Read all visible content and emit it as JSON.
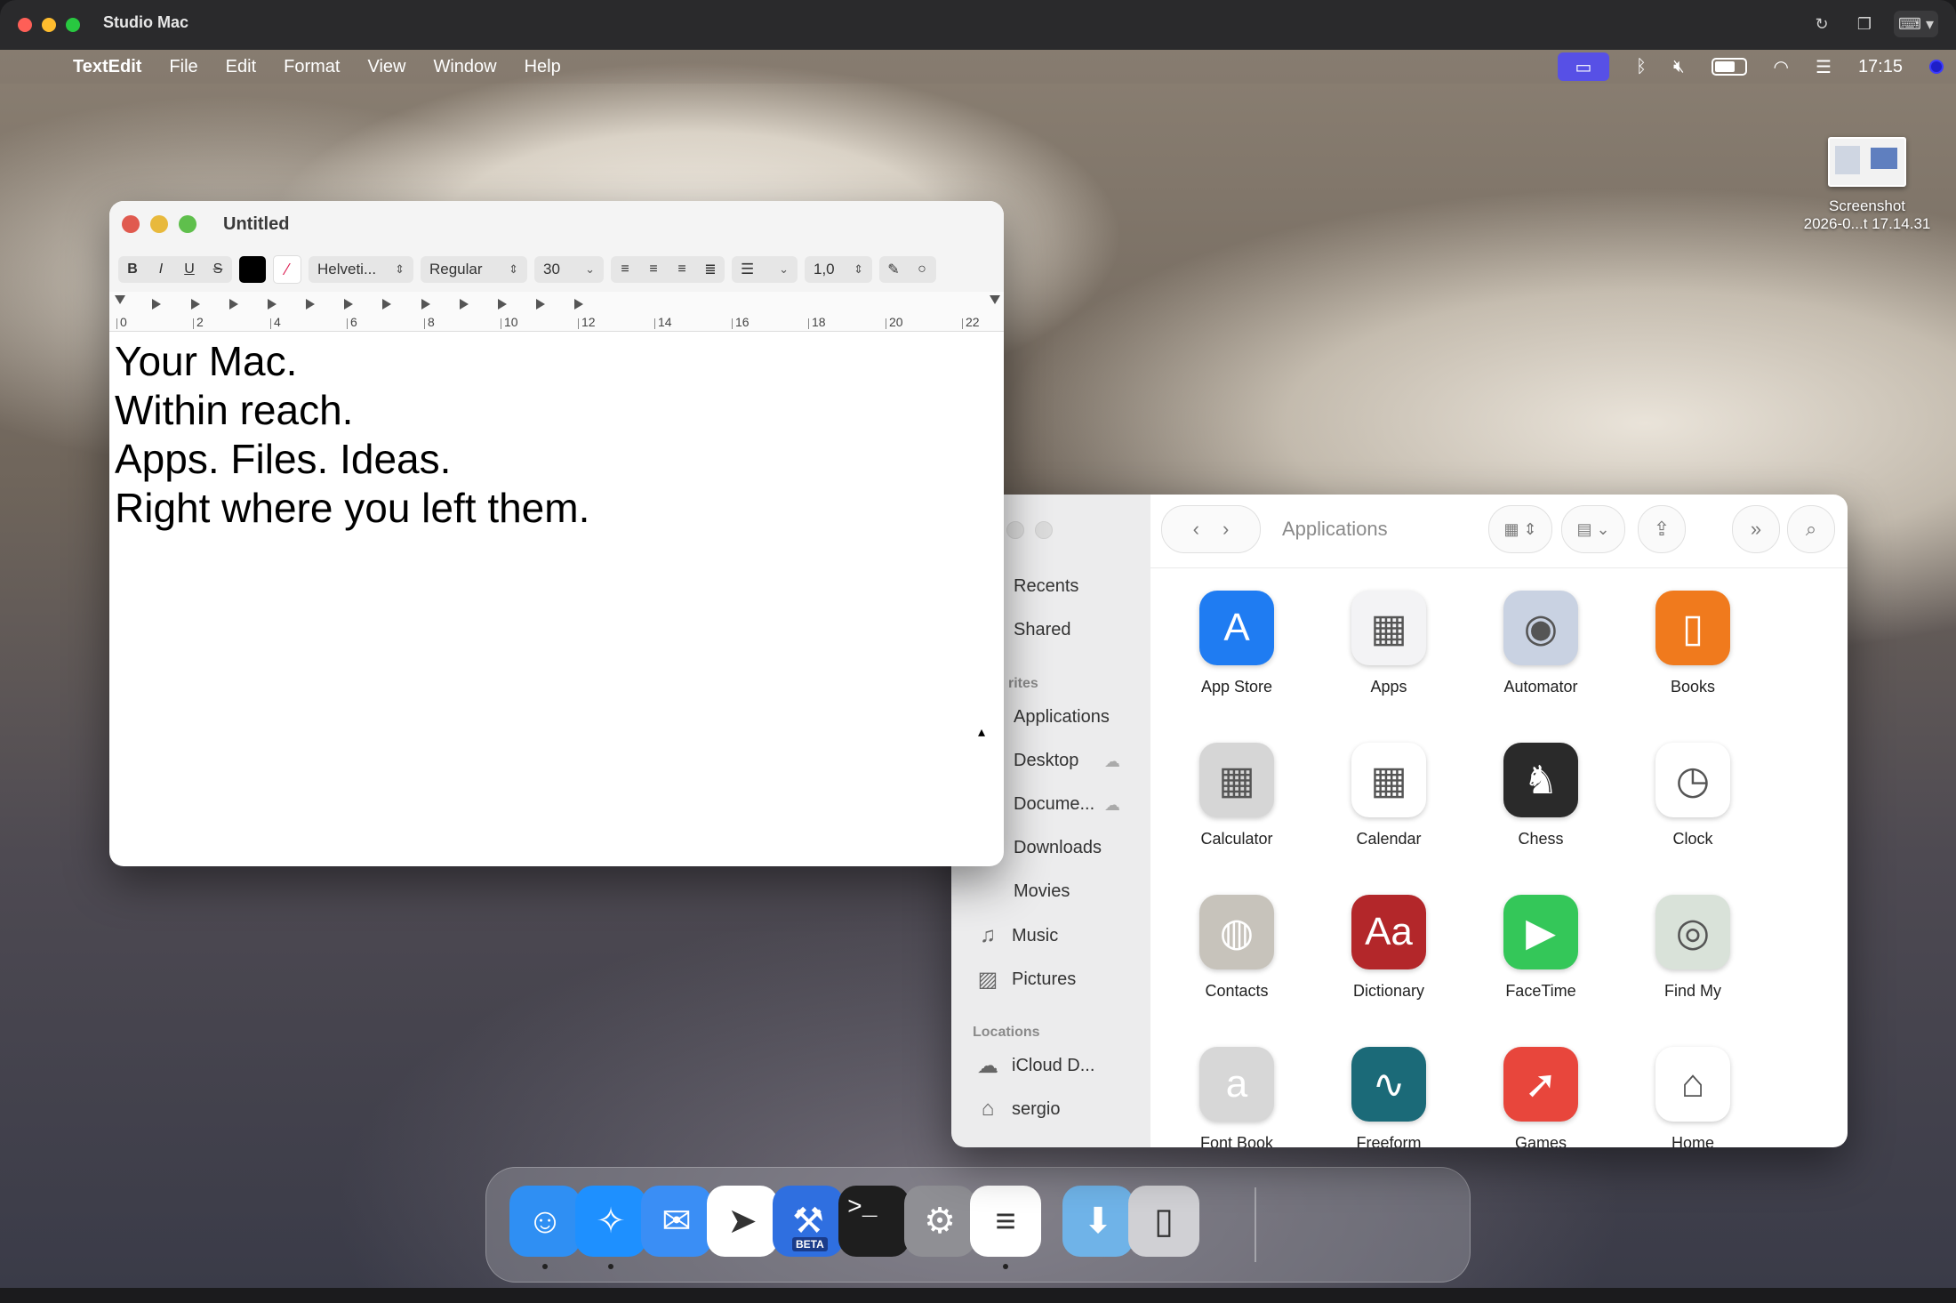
{
  "window": {
    "title": "Studio Mac"
  },
  "menubar": {
    "app": "TextEdit",
    "items": [
      "File",
      "Edit",
      "Format",
      "View",
      "Window",
      "Help"
    ],
    "clock": "17:15"
  },
  "desktop": {
    "file_label_line1": "Screenshot",
    "file_label_line2": "2026-0...t 17.14.31"
  },
  "textedit": {
    "title": "Untitled",
    "toolbar": {
      "bold": "B",
      "italic": "I",
      "underline": "U",
      "strike": "S",
      "font": "Helveti...",
      "style": "Regular",
      "size": "30",
      "spacing": "1,0"
    },
    "ruler": [
      "0",
      "2",
      "4",
      "6",
      "8",
      "10",
      "12",
      "14",
      "16",
      "18",
      "20",
      "22"
    ],
    "lines": [
      "Your Mac.",
      "Within reach.",
      "",
      "Apps. Files. Ideas.",
      "Right where you left them."
    ]
  },
  "finder": {
    "title": "Applications",
    "sidebar": {
      "recents": "Recents",
      "shared": "Shared",
      "favorites_header": "rites",
      "favorites": [
        "Applications",
        "Desktop",
        "Docume...",
        "Downloads",
        "Movies",
        "Music",
        "Pictures"
      ],
      "locations_header": "Locations",
      "locations": [
        "iCloud D...",
        "sergio"
      ]
    },
    "apps": [
      {
        "name": "App Store",
        "icon": "app-store-icon",
        "color": "#1f7cf2"
      },
      {
        "name": "Apps",
        "icon": "apps-icon",
        "color": "#f3f3f5"
      },
      {
        "name": "Automator",
        "icon": "automator-icon",
        "color": "#c9d2e2"
      },
      {
        "name": "Books",
        "icon": "books-icon",
        "color": "#f07a1d"
      },
      {
        "name": "Calculator",
        "icon": "calculator-icon",
        "color": "#d6d6d6"
      },
      {
        "name": "Calendar",
        "icon": "calendar-icon",
        "color": "#ffffff"
      },
      {
        "name": "Chess",
        "icon": "chess-icon",
        "color": "#2a2a2a"
      },
      {
        "name": "Clock",
        "icon": "clock-icon",
        "color": "#ffffff"
      },
      {
        "name": "Contacts",
        "icon": "contacts-icon",
        "color": "#c7c3bb"
      },
      {
        "name": "Dictionary",
        "icon": "dictionary-icon",
        "color": "#b3272a"
      },
      {
        "name": "FaceTime",
        "icon": "facetime-icon",
        "color": "#34c759"
      },
      {
        "name": "Find My",
        "icon": "find-my-icon",
        "color": "#d9e2d9"
      },
      {
        "name": "Font Book",
        "icon": "font-book-icon",
        "color": "#d7d7d7"
      },
      {
        "name": "Freeform",
        "icon": "freeform-icon",
        "color": "#1b6a78"
      },
      {
        "name": "Games",
        "icon": "games-icon",
        "color": "#e8463c"
      },
      {
        "name": "Home",
        "icon": "home-icon",
        "color": "#ffffff"
      }
    ]
  },
  "dock": [
    {
      "name": "finder",
      "icon": "finder-icon",
      "color": "#2f8ff3"
    },
    {
      "name": "safari",
      "icon": "safari-icon",
      "color": "#1e90ff"
    },
    {
      "name": "mail",
      "icon": "mail-icon",
      "color": "#3a8ef5"
    },
    {
      "name": "telegram",
      "icon": "telegram-icon",
      "color": "#ffffff"
    },
    {
      "name": "xcode-beta",
      "icon": "xcode-beta-icon",
      "color": "#2f6fe0",
      "badge": "BETA"
    },
    {
      "name": "terminal",
      "icon": "terminal-icon",
      "color": "#1e1e1e",
      "glyph": ">_"
    },
    {
      "name": "system-settings",
      "icon": "gear-icon",
      "color": "#8f8f94"
    },
    {
      "name": "textedit",
      "icon": "textedit-icon",
      "color": "#ffffff"
    },
    {
      "name": "downloads-folder",
      "icon": "downloads-folder-icon",
      "color": "#6fb3e8"
    },
    {
      "name": "trash",
      "icon": "trash-icon",
      "color": "#d0d0d4"
    }
  ]
}
